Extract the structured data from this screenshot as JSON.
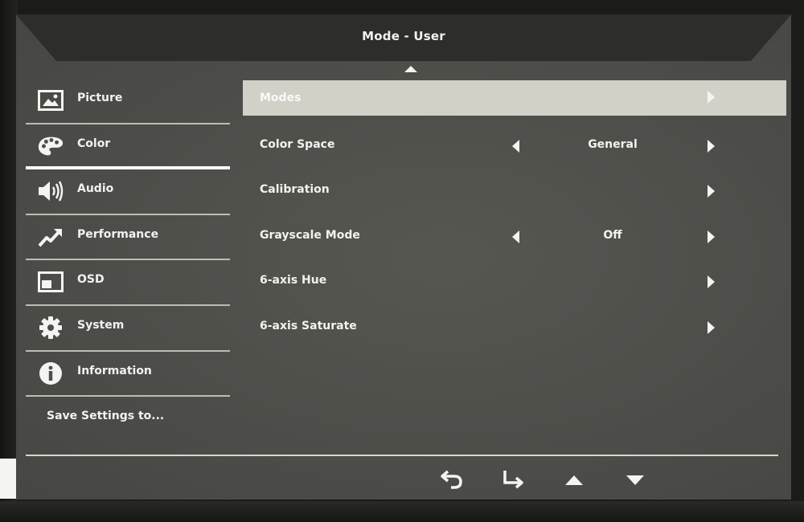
{
  "osd": {
    "title": "Mode - User"
  },
  "sidebar": {
    "items": [
      {
        "label": "Picture",
        "icon": "picture-icon"
      },
      {
        "label": "Color",
        "icon": "palette-icon",
        "active": true
      },
      {
        "label": "Audio",
        "icon": "speaker-icon"
      },
      {
        "label": "Performance",
        "icon": "performance-icon"
      },
      {
        "label": "OSD",
        "icon": "osd-icon"
      },
      {
        "label": "System",
        "icon": "gear-icon"
      },
      {
        "label": "Information",
        "icon": "info-icon"
      },
      {
        "label": "Save Settings to..."
      }
    ]
  },
  "menu": {
    "rows": [
      {
        "label": "Modes",
        "selected": true
      },
      {
        "label": "Color Space",
        "value": "General"
      },
      {
        "label": "Calibration"
      },
      {
        "label": "Grayscale Mode",
        "value": "Off"
      },
      {
        "label": "6-axis Hue"
      },
      {
        "label": "6-axis Saturate"
      }
    ]
  },
  "footer": {
    "buttons": [
      "back-icon",
      "enter-icon",
      "up-arrow-icon",
      "down-arrow-icon"
    ]
  },
  "colors": {
    "panel": "#4d4d49",
    "header": "#2d2d2a",
    "highlight": "#d2d1c8",
    "text": "#f2f2ee"
  }
}
